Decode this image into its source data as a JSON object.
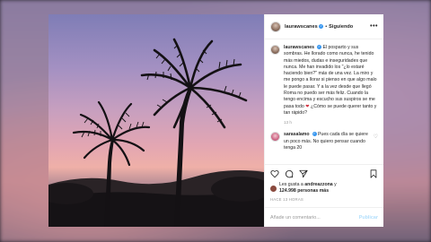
{
  "post": {
    "username": "laurawscanes",
    "separator": "•",
    "follow_label": "Siguiendo",
    "more_label": "•••",
    "caption_user": "laurawscanes",
    "caption_text": "El posparto y sus sombras. He llorado como nunca, he tenido más miedos, dudas e inseguridades que nunca. Me han invadido los \"¿lo estaré haciendo bien?\" más de una vez. La miro y me pongo a llorar si pienso en que algo malo le puede pasar. Y a la vez desde que llegó Roma no puedo ser más feliz. Cuando la tengo encima y escucho sus suspiros se me pasa todo",
    "caption_emoji": "❤",
    "caption_end": " ¿Cómo se puede querer tanto y tan rápido?",
    "caption_time": "13 h",
    "reply_user": "sarasalamo",
    "reply_text": "Pues cada día se quiere un poco más. No quiero pensar cuando tenga 20",
    "likes_prefix": "Les gusta a ",
    "likes_user": "andreazzona",
    "likes_and": " y",
    "likes_count": "124.998 personas más",
    "post_time": "HACE 13 HORAS",
    "comment_placeholder": "Añade un comentario...",
    "publish_label": "Publicar"
  },
  "icons": [
    "verified-icon",
    "heart-icon",
    "comment-icon",
    "share-icon",
    "save-icon",
    "more-icon"
  ],
  "colors": {
    "accent": "#3897f0",
    "publish_disabled": "#b2dffc",
    "text": "#262626",
    "muted": "#999999"
  }
}
